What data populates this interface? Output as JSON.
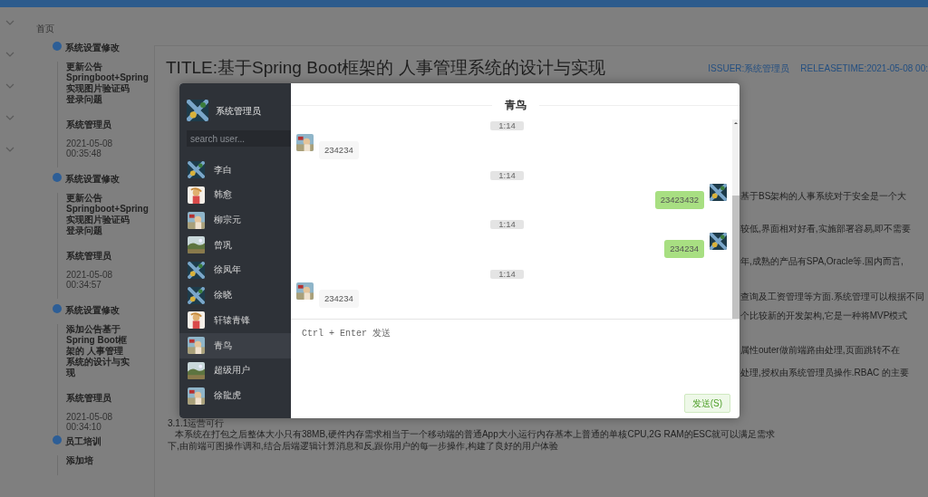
{
  "breadcrumb": "首页",
  "timeline": [
    {
      "title": "系统设置修改",
      "content_lines": [
        "更新公告",
        "Springboot+Spring",
        "实现图片验证码",
        "登录问题"
      ],
      "author": "系统管理员",
      "time": "2021-05-08 00:35:48"
    },
    {
      "title": "系统设置修改",
      "content_lines": [
        "更新公告",
        "Springboot+Spring",
        "实现图片验证码",
        "登录问题"
      ],
      "author": "系统管理员",
      "time": "2021-05-08 00:34:57"
    },
    {
      "title": "系统设置修改",
      "content_lines": [
        "添加公告基于",
        "Spring Boot框",
        "架的 人事管理",
        "系统的设计与实",
        "现"
      ],
      "author": "系统管理员",
      "time": "2021-05-08 00:34:10"
    },
    {
      "title": "员工培训",
      "content_lines": [
        "添加培"
      ]
    }
  ],
  "article": {
    "title": "TITLE:基于Spring Boot框架的 人事管理系统的设计与实现",
    "issuer": "ISSUER:系统管理员",
    "release_time": "RELEASETIME:2021-05-08 00:",
    "right_fragments": [
      "基于BS架构的人事系统对于安全是一个大",
      "较低,界面相对好看,实施部署容易,即不需要",
      "年,成熟的产品有SPA,Oracle等.国内而言,",
      "查询及工资管理等方面.系统管理可以根据不同",
      "个比较新的开发架构,它是一种将MVP模式",
      "属性outer做前端路由处理,页面跳转不在",
      "处理,授权由系统管理员操作.RBAC 的主要"
    ],
    "bottom_lines": [
      "3.1.1运营可行",
      "本系统在打包之后整体大小只有38MB,硬件内存需求相当于一个移动端的普通App大小,运行内存基本上普通的单核CPU,2G RAM的ESC就可以满足需求",
      "下,由前端可图操作调和,结合后端逻辑计算消息和反,跟你用户的每一步操作,构建了良好的用户体验"
    ]
  },
  "chat": {
    "user": "系统管理员",
    "search": {
      "placeholder": "search user..."
    },
    "contacts": [
      {
        "name": "李白",
        "selected": false
      },
      {
        "name": "韩愈",
        "selected": false
      },
      {
        "name": "柳宗元",
        "selected": false
      },
      {
        "name": "曾巩",
        "selected": false
      },
      {
        "name": "徐凤年",
        "selected": false
      },
      {
        "name": "徐晓",
        "selected": false
      },
      {
        "name": "轩辕青锋",
        "selected": false
      },
      {
        "name": "青鸟",
        "selected": true
      },
      {
        "name": "超级用户",
        "selected": false
      },
      {
        "name": "徐龍虎",
        "selected": false
      }
    ],
    "title": "青鸟",
    "messages": [
      {
        "time": "1:14",
        "text": "234234",
        "mine": false
      },
      {
        "time": "1:14",
        "text": "23423432",
        "mine": true
      },
      {
        "time": "1:14",
        "text": "234234",
        "mine": true
      },
      {
        "time": "1:14",
        "text": "234234",
        "mine": false
      }
    ],
    "input": {
      "placeholder": "Ctrl + Enter 发送"
    },
    "send_button": "发送(S)"
  }
}
